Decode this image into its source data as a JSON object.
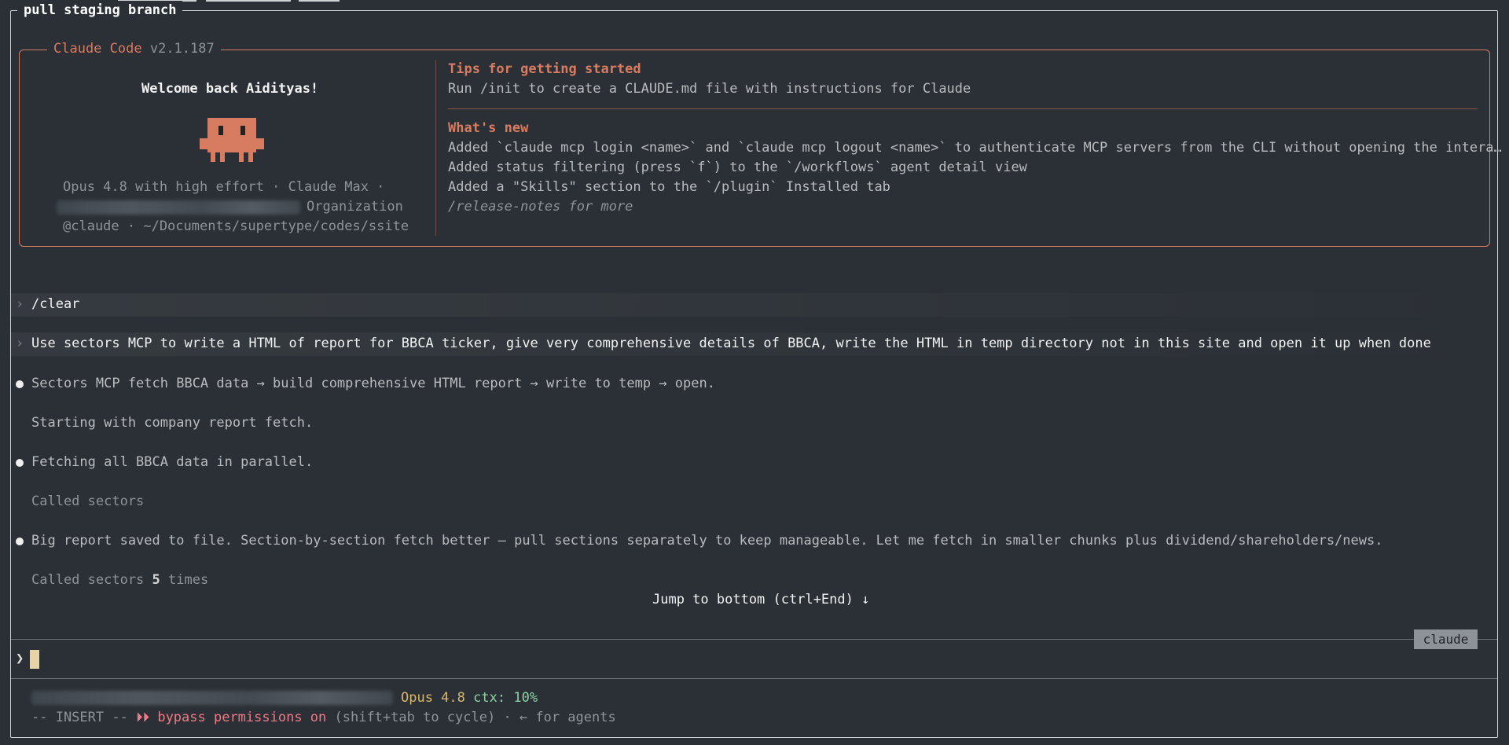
{
  "pane": {
    "title": "pull staging branch"
  },
  "welcome": {
    "app_name": "Claude Code",
    "version": "v2.1.187",
    "greeting": "Welcome back Aidityas!",
    "model_line": "Opus 4.8 with high effort · Claude Max ·",
    "org_suffix": "Organization",
    "path_line": "@claude · ~/Documents/supertype/codes/ssite",
    "tips_heading": "Tips for getting started",
    "tips_text": "Run /init to create a CLAUDE.md file with instructions for Claude",
    "whats_new_heading": "What's new",
    "whats_new": [
      "Added `claude mcp login <name>` and `claude mcp logout <name>` to authenticate MCP servers from the CLI without opening the intera…",
      "Added status filtering (press `f`) to the `/workflows` agent detail view",
      "Added a \"Skills\" section to the `/plugin` Installed tab"
    ],
    "release_notes": "/release-notes for more"
  },
  "transcript": {
    "prompt_glyph": "›",
    "cmd_clear": "/clear",
    "user_prompt": "Use sectors MCP to write a HTML of report for BBCA ticker, give very comprehensive details of BBCA, write the HTML in temp directory not in this site and open it up when done",
    "msg1": "Sectors MCP fetch BBCA data → build comprehensive HTML report → write to temp → open.",
    "msg1_sub": "Starting with company report fetch.",
    "msg2": "Fetching all BBCA data in parallel.",
    "msg2_sub": "Called sectors",
    "msg3": "Big report saved to file. Section-by-section fetch better — pull sections separately to keep manageable. Let me fetch in smaller chunks plus dividend/shareholders/news.",
    "msg3_sub_prefix": "Called sectors ",
    "msg3_sub_count": "5",
    "msg3_sub_suffix": " times",
    "jump": "Jump to bottom (ctrl+End) ↓"
  },
  "input": {
    "prompt_glyph": "❯",
    "tag": "claude"
  },
  "status": {
    "model": "Opus 4.8",
    "ctx_label": "ctx:",
    "ctx_value": "10%",
    "mode": "-- INSERT --",
    "bypass_glyph": "⏵⏵",
    "bypass_text": "bypass permissions on",
    "hint": " (shift+tab to cycle) · ← for agents"
  },
  "colors": {
    "accent": "#d77b61",
    "background": "#2b3036",
    "green": "#8fd0a4",
    "red": "#ef7b86"
  }
}
